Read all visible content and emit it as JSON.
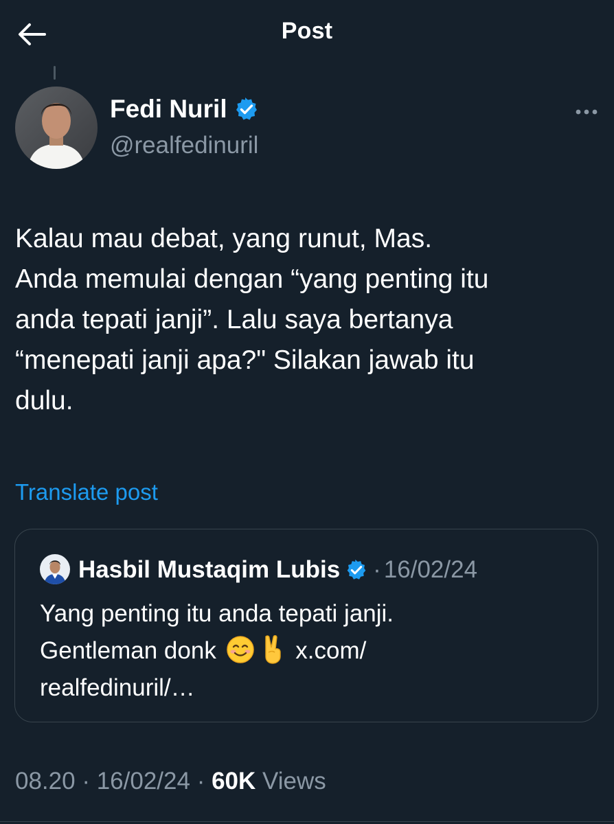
{
  "header": {
    "title": "Post",
    "back_icon": "arrow-left-icon"
  },
  "post": {
    "author": {
      "name": "Fedi Nuril",
      "handle": "@realfedinuril",
      "verified": true
    },
    "text_lines": [
      "Kalau mau debat, yang runut, Mas.",
      "Anda memulai dengan “yang penting itu",
      "anda tepati janji”. Lalu saya bertanya",
      "“menepati janji apa?\" Silakan jawab itu",
      "dulu."
    ],
    "translate_label": "Translate post",
    "time": "08.20",
    "date": "16/02/24",
    "views_count": "60K",
    "views_label": "Views"
  },
  "quote": {
    "author_name": "Hasbil Mustaqim Lubis",
    "verified": true,
    "date": "16/02/24",
    "line1": "Yang penting itu anda tepati janji.",
    "line2_text": "Gentleman donk",
    "line2_link": "x.com/",
    "line3": "realfedinuril/…"
  },
  "colors": {
    "background": "#15202b",
    "text_primary": "#ffffff",
    "text_secondary": "#8b98a5",
    "accent": "#1d9bf0",
    "border": "#38444d"
  }
}
